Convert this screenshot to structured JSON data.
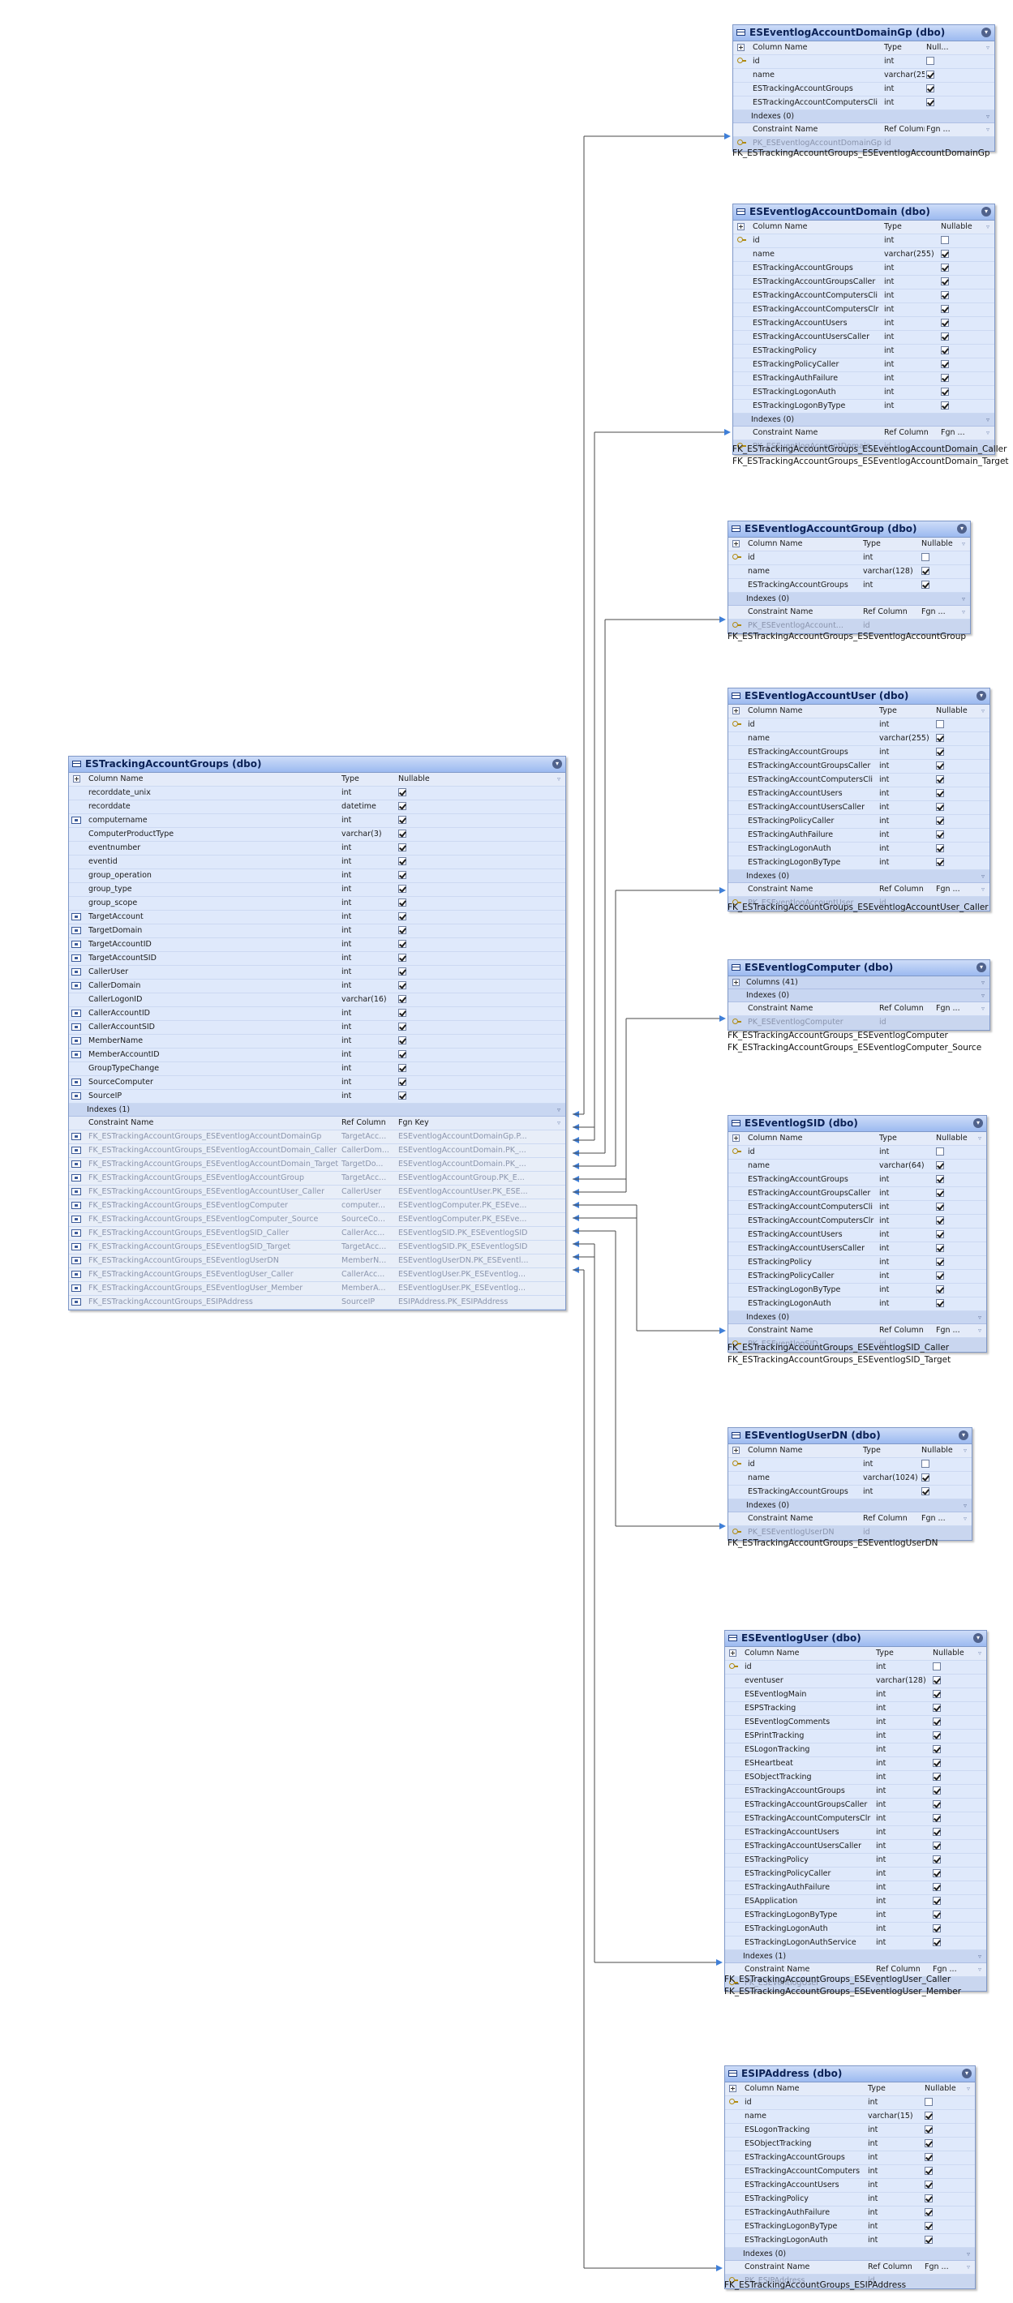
{
  "headers": {
    "column_name": "Column Name",
    "type": "Type",
    "nullable": "Nullable",
    "constraint_name": "Constraint Name",
    "ref_column": "Ref Column",
    "fgn_key": "Fgn Key",
    "fgn_short": "Fgn ...",
    "null_short": "Null..."
  },
  "main": {
    "title": "ESTrackingAccountGroups (dbo)",
    "columns": [
      {
        "name": "recorddate_unix",
        "type": "int",
        "nullable": true,
        "icon": "none"
      },
      {
        "name": "recorddate",
        "type": "datetime",
        "nullable": true,
        "icon": "none"
      },
      {
        "name": "computername",
        "type": "int",
        "nullable": true,
        "icon": "fk-icon"
      },
      {
        "name": "ComputerProductType",
        "type": "varchar(3)",
        "nullable": true,
        "icon": "none"
      },
      {
        "name": "eventnumber",
        "type": "int",
        "nullable": true,
        "icon": "none"
      },
      {
        "name": "eventid",
        "type": "int",
        "nullable": true,
        "icon": "none"
      },
      {
        "name": "group_operation",
        "type": "int",
        "nullable": true,
        "icon": "none"
      },
      {
        "name": "group_type",
        "type": "int",
        "nullable": true,
        "icon": "none"
      },
      {
        "name": "group_scope",
        "type": "int",
        "nullable": true,
        "icon": "none"
      },
      {
        "name": "TargetAccount",
        "type": "int",
        "nullable": true,
        "icon": "fk-icon"
      },
      {
        "name": "TargetDomain",
        "type": "int",
        "nullable": true,
        "icon": "fk-icon"
      },
      {
        "name": "TargetAccountID",
        "type": "int",
        "nullable": true,
        "icon": "fk-icon"
      },
      {
        "name": "TargetAccountSID",
        "type": "int",
        "nullable": true,
        "icon": "fk-icon"
      },
      {
        "name": "CallerUser",
        "type": "int",
        "nullable": true,
        "icon": "fk-icon"
      },
      {
        "name": "CallerDomain",
        "type": "int",
        "nullable": true,
        "icon": "fk-icon"
      },
      {
        "name": "CallerLogonID",
        "type": "varchar(16)",
        "nullable": true,
        "icon": "none"
      },
      {
        "name": "CallerAccountID",
        "type": "int",
        "nullable": true,
        "icon": "fk-icon"
      },
      {
        "name": "CallerAccountSID",
        "type": "int",
        "nullable": true,
        "icon": "fk-icon"
      },
      {
        "name": "MemberName",
        "type": "int",
        "nullable": true,
        "icon": "fk-icon"
      },
      {
        "name": "MemberAccountID",
        "type": "int",
        "nullable": true,
        "icon": "fk-icon"
      },
      {
        "name": "GroupTypeChange",
        "type": "int",
        "nullable": true,
        "icon": "none"
      },
      {
        "name": "SourceComputer",
        "type": "int",
        "nullable": true,
        "icon": "fk-icon"
      },
      {
        "name": "SourceIP",
        "type": "int",
        "nullable": true,
        "icon": "fk-icon"
      }
    ],
    "indexes": "Indexes (1)",
    "constraints": [
      {
        "name": "FK_ESTrackingAccountGroups_ESEventlogAccountDomainGp",
        "ref": "TargetAcc...",
        "fgn": "ESEventlogAccountDomainGp.P..."
      },
      {
        "name": "FK_ESTrackingAccountGroups_ESEventlogAccountDomain_Caller",
        "ref": "CallerDom...",
        "fgn": "ESEventlogAccountDomain.PK_..."
      },
      {
        "name": "FK_ESTrackingAccountGroups_ESEventlogAccountDomain_Target",
        "ref": "TargetDo...",
        "fgn": "ESEventlogAccountDomain.PK_..."
      },
      {
        "name": "FK_ESTrackingAccountGroups_ESEventlogAccountGroup",
        "ref": "TargetAcc...",
        "fgn": "ESEventlogAccountGroup.PK_E..."
      },
      {
        "name": "FK_ESTrackingAccountGroups_ESEventlogAccountUser_Caller",
        "ref": "CallerUser",
        "fgn": "ESEventlogAccountUser.PK_ESE..."
      },
      {
        "name": "FK_ESTrackingAccountGroups_ESEventlogComputer",
        "ref": "computer...",
        "fgn": "ESEventlogComputer.PK_ESEve..."
      },
      {
        "name": "FK_ESTrackingAccountGroups_ESEventlogComputer_Source",
        "ref": "SourceCo...",
        "fgn": "ESEventlogComputer.PK_ESEve..."
      },
      {
        "name": "FK_ESTrackingAccountGroups_ESEventlogSID_Caller",
        "ref": "CallerAcc...",
        "fgn": "ESEventlogSID.PK_ESEventlogSID"
      },
      {
        "name": "FK_ESTrackingAccountGroups_ESEventlogSID_Target",
        "ref": "TargetAcc...",
        "fgn": "ESEventlogSID.PK_ESEventlogSID"
      },
      {
        "name": "FK_ESTrackingAccountGroups_ESEventlogUserDN",
        "ref": "MemberN...",
        "fgn": "ESEventlogUserDN.PK_ESEventl..."
      },
      {
        "name": "FK_ESTrackingAccountGroups_ESEventlogUser_Caller",
        "ref": "CallerAcc...",
        "fgn": "ESEventlogUser.PK_ESEventlog..."
      },
      {
        "name": "FK_ESTrackingAccountGroups_ESEventlogUser_Member",
        "ref": "MemberA...",
        "fgn": "ESEventlogUser.PK_ESEventlog..."
      },
      {
        "name": "FK_ESTrackingAccountGroups_ESIPAddress",
        "ref": "SourceIP",
        "fgn": "ESIPAddress.PK_ESIPAddress"
      }
    ]
  },
  "tables": [
    {
      "id": "domaingp",
      "title": "ESEventlogAccountDomainGp (dbo)",
      "columns": [
        {
          "name": "id",
          "type": "int",
          "nullable": false,
          "icon": "key-icon"
        },
        {
          "name": "name",
          "type": "varchar(255)",
          "nullable": true,
          "icon": "none"
        },
        {
          "name": "ESTrackingAccountGroups",
          "type": "int",
          "nullable": true,
          "icon": "none"
        },
        {
          "name": "ESTrackingAccountComputersCli",
          "type": "int",
          "nullable": true,
          "icon": "none"
        }
      ],
      "indexes": "Indexes (0)",
      "constraint": "PK_ESEventlogAccountDomainGp",
      "ref": "id",
      "fk_labels": [
        "FK_ESTrackingAccountGroups_ESEventlogAccountDomainGp"
      ]
    },
    {
      "id": "domain",
      "title": "ESEventlogAccountDomain (dbo)",
      "columns": [
        {
          "name": "id",
          "type": "int",
          "nullable": false,
          "icon": "key-icon"
        },
        {
          "name": "name",
          "type": "varchar(255)",
          "nullable": true,
          "icon": "none"
        },
        {
          "name": "ESTrackingAccountGroups",
          "type": "int",
          "nullable": true,
          "icon": "none"
        },
        {
          "name": "ESTrackingAccountGroupsCaller",
          "type": "int",
          "nullable": true,
          "icon": "none"
        },
        {
          "name": "ESTrackingAccountComputersCli",
          "type": "int",
          "nullable": true,
          "icon": "none"
        },
        {
          "name": "ESTrackingAccountComputersClr",
          "type": "int",
          "nullable": true,
          "icon": "none"
        },
        {
          "name": "ESTrackingAccountUsers",
          "type": "int",
          "nullable": true,
          "icon": "none"
        },
        {
          "name": "ESTrackingAccountUsersCaller",
          "type": "int",
          "nullable": true,
          "icon": "none"
        },
        {
          "name": "ESTrackingPolicy",
          "type": "int",
          "nullable": true,
          "icon": "none"
        },
        {
          "name": "ESTrackingPolicyCaller",
          "type": "int",
          "nullable": true,
          "icon": "none"
        },
        {
          "name": "ESTrackingAuthFailure",
          "type": "int",
          "nullable": true,
          "icon": "none"
        },
        {
          "name": "ESTrackingLogonAuth",
          "type": "int",
          "nullable": true,
          "icon": "none"
        },
        {
          "name": "ESTrackingLogonByType",
          "type": "int",
          "nullable": true,
          "icon": "none"
        }
      ],
      "indexes": "Indexes (0)",
      "constraint": "PK_ESEventlogAccountDomain",
      "ref": "id",
      "fk_labels": [
        "FK_ESTrackingAccountGroups_ESEventlogAccountDomain_Caller",
        "FK_ESTrackingAccountGroups_ESEventlogAccountDomain_Target"
      ]
    },
    {
      "id": "group",
      "title": "ESEventlogAccountGroup (dbo)",
      "columns": [
        {
          "name": "id",
          "type": "int",
          "nullable": false,
          "icon": "key-icon"
        },
        {
          "name": "name",
          "type": "varchar(128)",
          "nullable": true,
          "icon": "none"
        },
        {
          "name": "ESTrackingAccountGroups",
          "type": "int",
          "nullable": true,
          "icon": "none"
        }
      ],
      "indexes": "Indexes (0)",
      "constraint": "PK_ESEventlogAccount...",
      "ref": "id",
      "fk_labels": [
        "FK_ESTrackingAccountGroups_ESEventlogAccountGroup"
      ]
    },
    {
      "id": "user",
      "title": "ESEventlogAccountUser (dbo)",
      "columns": [
        {
          "name": "id",
          "type": "int",
          "nullable": false,
          "icon": "key-icon"
        },
        {
          "name": "name",
          "type": "varchar(255)",
          "nullable": true,
          "icon": "none"
        },
        {
          "name": "ESTrackingAccountGroups",
          "type": "int",
          "nullable": true,
          "icon": "none"
        },
        {
          "name": "ESTrackingAccountGroupsCaller",
          "type": "int",
          "nullable": true,
          "icon": "none"
        },
        {
          "name": "ESTrackingAccountComputersCli",
          "type": "int",
          "nullable": true,
          "icon": "none"
        },
        {
          "name": "ESTrackingAccountUsers",
          "type": "int",
          "nullable": true,
          "icon": "none"
        },
        {
          "name": "ESTrackingAccountUsersCaller",
          "type": "int",
          "nullable": true,
          "icon": "none"
        },
        {
          "name": "ESTrackingPolicyCaller",
          "type": "int",
          "nullable": true,
          "icon": "none"
        },
        {
          "name": "ESTrackingAuthFailure",
          "type": "int",
          "nullable": true,
          "icon": "none"
        },
        {
          "name": "ESTrackingLogonAuth",
          "type": "int",
          "nullable": true,
          "icon": "none"
        },
        {
          "name": "ESTrackingLogonByType",
          "type": "int",
          "nullable": true,
          "icon": "none"
        }
      ],
      "indexes": "Indexes (0)",
      "constraint": "PK_ESEventlogAccountUser",
      "ref": "id",
      "fk_labels": [
        "FK_ESTrackingAccountGroups_ESEventlogAccountUser_Caller"
      ]
    },
    {
      "id": "computer",
      "title": "ESEventlogComputer (dbo)",
      "columns_collapsed": "Columns (41)",
      "columns": [],
      "indexes": "Indexes (0)",
      "constraint": "PK_ESEventlogComputer",
      "ref": "id",
      "fk_labels": [
        "FK_ESTrackingAccountGroups_ESEventlogComputer",
        "FK_ESTrackingAccountGroups_ESEventlogComputer_Source"
      ]
    },
    {
      "id": "sid",
      "title": "ESEventlogSID (dbo)",
      "columns": [
        {
          "name": "id",
          "type": "int",
          "nullable": false,
          "icon": "key-icon"
        },
        {
          "name": "name",
          "type": "varchar(64)",
          "nullable": true,
          "icon": "none"
        },
        {
          "name": "ESTrackingAccountGroups",
          "type": "int",
          "nullable": true,
          "icon": "none"
        },
        {
          "name": "ESTrackingAccountGroupsCaller",
          "type": "int",
          "nullable": true,
          "icon": "none"
        },
        {
          "name": "ESTrackingAccountComputersCli",
          "type": "int",
          "nullable": true,
          "icon": "none"
        },
        {
          "name": "ESTrackingAccountComputersClr",
          "type": "int",
          "nullable": true,
          "icon": "none"
        },
        {
          "name": "ESTrackingAccountUsers",
          "type": "int",
          "nullable": true,
          "icon": "none"
        },
        {
          "name": "ESTrackingAccountUsersCaller",
          "type": "int",
          "nullable": true,
          "icon": "none"
        },
        {
          "name": "ESTrackingPolicy",
          "type": "int",
          "nullable": true,
          "icon": "none"
        },
        {
          "name": "ESTrackingPolicyCaller",
          "type": "int",
          "nullable": true,
          "icon": "none"
        },
        {
          "name": "ESTrackingLogonByType",
          "type": "int",
          "nullable": true,
          "icon": "none"
        },
        {
          "name": "ESTrackingLogonAuth",
          "type": "int",
          "nullable": true,
          "icon": "none"
        }
      ],
      "indexes": "Indexes (0)",
      "constraint": "PK_ESEventlogSID",
      "ref": "id",
      "fk_labels": [
        "FK_ESTrackingAccountGroups_ESEventlogSID_Caller",
        "FK_ESTrackingAccountGroups_ESEventlogSID_Target"
      ]
    },
    {
      "id": "userdn",
      "title": "ESEventlogUserDN (dbo)",
      "columns": [
        {
          "name": "id",
          "type": "int",
          "nullable": false,
          "icon": "key-icon"
        },
        {
          "name": "name",
          "type": "varchar(1024)",
          "nullable": true,
          "icon": "none"
        },
        {
          "name": "ESTrackingAccountGroups",
          "type": "int",
          "nullable": true,
          "icon": "none"
        }
      ],
      "indexes": "Indexes (0)",
      "constraint": "PK_ESEventlogUserDN",
      "ref": "id",
      "fk_labels": [
        "FK_ESTrackingAccountGroups_ESEventlogUserDN"
      ]
    },
    {
      "id": "euser",
      "title": "ESEventlogUser (dbo)",
      "columns": [
        {
          "name": "id",
          "type": "int",
          "nullable": false,
          "icon": "key-icon"
        },
        {
          "name": "eventuser",
          "type": "varchar(128)",
          "nullable": true,
          "icon": "none"
        },
        {
          "name": "ESEventlogMain",
          "type": "int",
          "nullable": true,
          "icon": "none"
        },
        {
          "name": "ESPSTracking",
          "type": "int",
          "nullable": true,
          "icon": "none"
        },
        {
          "name": "ESEventlogComments",
          "type": "int",
          "nullable": true,
          "icon": "none"
        },
        {
          "name": "ESPrintTracking",
          "type": "int",
          "nullable": true,
          "icon": "none"
        },
        {
          "name": "ESLogonTracking",
          "type": "int",
          "nullable": true,
          "icon": "none"
        },
        {
          "name": "ESHeartbeat",
          "type": "int",
          "nullable": true,
          "icon": "none"
        },
        {
          "name": "ESObjectTracking",
          "type": "int",
          "nullable": true,
          "icon": "none"
        },
        {
          "name": "ESTrackingAccountGroups",
          "type": "int",
          "nullable": true,
          "icon": "none"
        },
        {
          "name": "ESTrackingAccountGroupsCaller",
          "type": "int",
          "nullable": true,
          "icon": "none"
        },
        {
          "name": "ESTrackingAccountComputersClr",
          "type": "int",
          "nullable": true,
          "icon": "none"
        },
        {
          "name": "ESTrackingAccountUsers",
          "type": "int",
          "nullable": true,
          "icon": "none"
        },
        {
          "name": "ESTrackingAccountUsersCaller",
          "type": "int",
          "nullable": true,
          "icon": "none"
        },
        {
          "name": "ESTrackingPolicy",
          "type": "int",
          "nullable": true,
          "icon": "none"
        },
        {
          "name": "ESTrackingPolicyCaller",
          "type": "int",
          "nullable": true,
          "icon": "none"
        },
        {
          "name": "ESTrackingAuthFailure",
          "type": "int",
          "nullable": true,
          "icon": "none"
        },
        {
          "name": "ESApplication",
          "type": "int",
          "nullable": true,
          "icon": "none"
        },
        {
          "name": "ESTrackingLogonByType",
          "type": "int",
          "nullable": true,
          "icon": "none"
        },
        {
          "name": "ESTrackingLogonAuth",
          "type": "int",
          "nullable": true,
          "icon": "none"
        },
        {
          "name": "ESTrackingLogonAuthService",
          "type": "int",
          "nullable": true,
          "icon": "none"
        }
      ],
      "indexes": "Indexes (1)",
      "constraint": "PK_ESEventlogUser",
      "ref": "id",
      "fk_labels": [
        "FK_ESTrackingAccountGroups_ESEventlogUser_Caller",
        "FK_ESTrackingAccountGroups_ESEventlogUser_Member"
      ]
    },
    {
      "id": "ip",
      "title": "ESIPAddress (dbo)",
      "columns": [
        {
          "name": "id",
          "type": "int",
          "nullable": false,
          "icon": "key-icon"
        },
        {
          "name": "name",
          "type": "varchar(15)",
          "nullable": true,
          "icon": "none"
        },
        {
          "name": "ESLogonTracking",
          "type": "int",
          "nullable": true,
          "icon": "none"
        },
        {
          "name": "ESObjectTracking",
          "type": "int",
          "nullable": true,
          "icon": "none"
        },
        {
          "name": "ESTrackingAccountGroups",
          "type": "int",
          "nullable": true,
          "icon": "none"
        },
        {
          "name": "ESTrackingAccountComputers",
          "type": "int",
          "nullable": true,
          "icon": "none"
        },
        {
          "name": "ESTrackingAccountUsers",
          "type": "int",
          "nullable": true,
          "icon": "none"
        },
        {
          "name": "ESTrackingPolicy",
          "type": "int",
          "nullable": true,
          "icon": "none"
        },
        {
          "name": "ESTrackingAuthFailure",
          "type": "int",
          "nullable": true,
          "icon": "none"
        },
        {
          "name": "ESTrackingLogonByType",
          "type": "int",
          "nullable": true,
          "icon": "none"
        },
        {
          "name": "ESTrackingLogonAuth",
          "type": "int",
          "nullable": true,
          "icon": "none"
        }
      ],
      "indexes": "Indexes (0)",
      "constraint": "PK_ESIPAddress",
      "ref": "id",
      "fk_labels": [
        "FK_ESTrackingAccountGroups_ESIPAddress"
      ]
    }
  ]
}
